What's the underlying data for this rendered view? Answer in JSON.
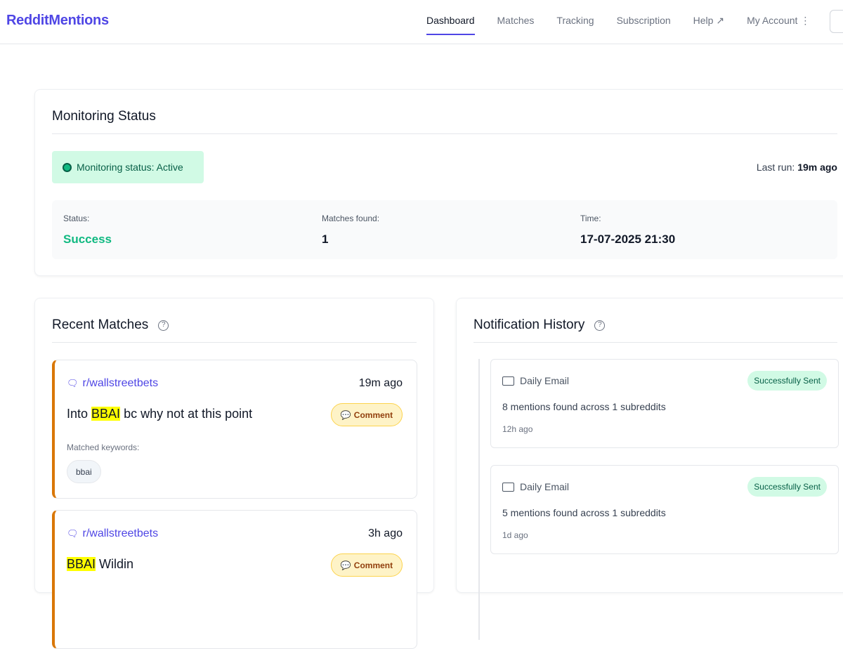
{
  "header": {
    "logo": "RedditMentions",
    "nav": [
      "Dashboard",
      "Matches",
      "Tracking",
      "Subscription",
      "Help ↗",
      "My Account ⋮"
    ]
  },
  "monitoring": {
    "title": "Monitoring Status",
    "badge": "Monitoring status: Active",
    "last_run_label": "Last run:",
    "last_run_value": "19m ago",
    "stats": [
      {
        "label": "Status:",
        "value": "Success"
      },
      {
        "label": "Matches found:",
        "value": "1"
      },
      {
        "label": "Time:",
        "value": "17-07-2025 21:30"
      }
    ]
  },
  "recent": {
    "title": "Recent Matches",
    "matches": [
      {
        "subreddit": "r/wallstreetbets",
        "time": "19m ago",
        "highlight": "BBAI",
        "title_rest": " bc why not at this point",
        "title_pre": "Into ",
        "type": "Comment",
        "keywords_label": "Matched keywords:",
        "keyword": "bbai"
      },
      {
        "subreddit": "r/wallstreetbets",
        "time": "3h ago",
        "highlight": "BBAI",
        "title_rest": " Wildin",
        "title_pre": "",
        "type": "Comment"
      }
    ]
  },
  "notifications": {
    "title": "Notification History",
    "items": [
      {
        "type": "Daily Email",
        "status": "Successfully Sent",
        "desc": "8 mentions found across 1 subreddits",
        "ago": "12h ago"
      },
      {
        "type": "Daily Email",
        "status": "Successfully Sent",
        "desc": "5 mentions found across 1 subreddits",
        "ago": "1d ago"
      }
    ]
  },
  "colors": {
    "brand": "#4f46e5",
    "success": "#10b981",
    "accent": "#d97706"
  }
}
